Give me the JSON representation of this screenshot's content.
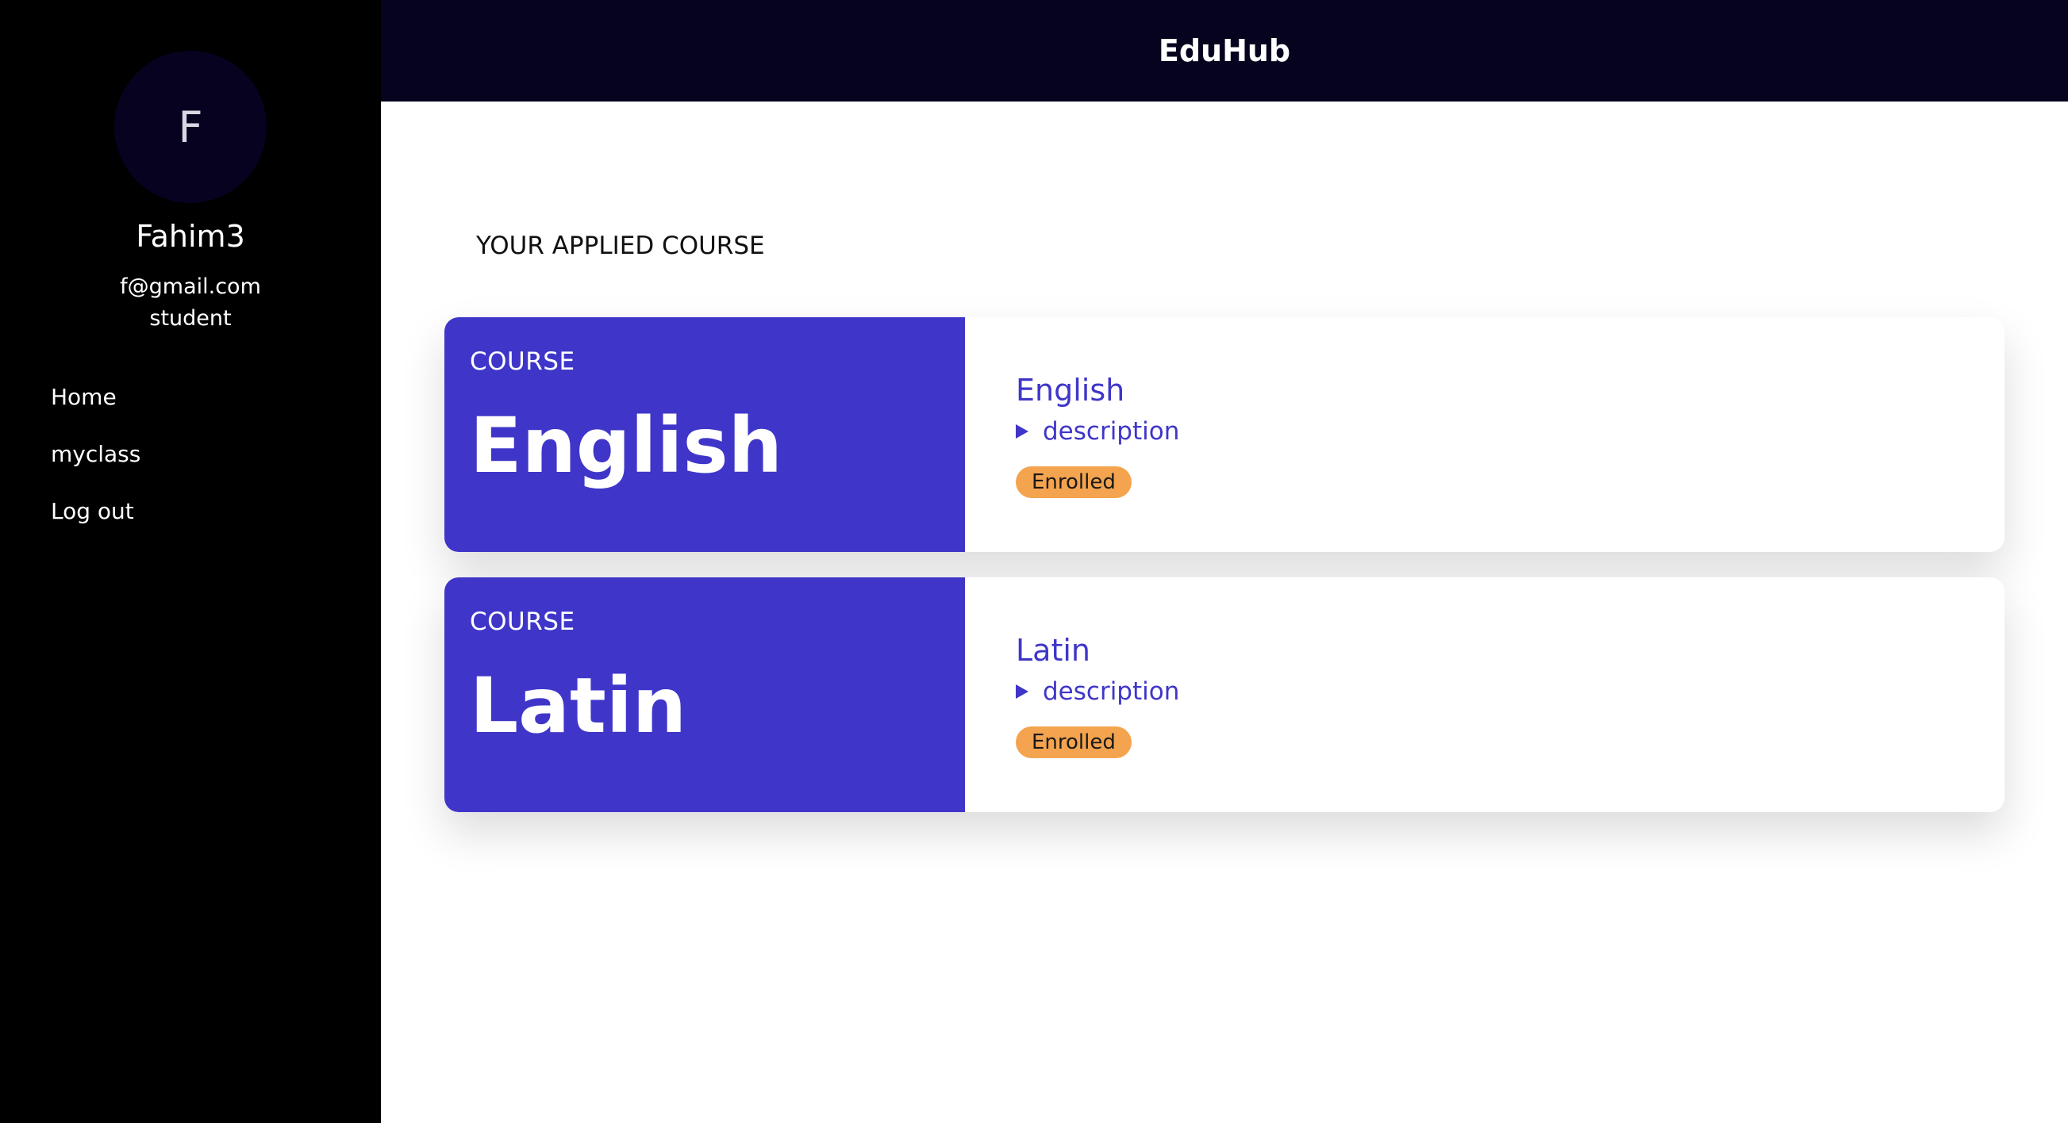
{
  "app": {
    "title": "EduHub"
  },
  "user": {
    "initial": "F",
    "name": "Fahim3",
    "email": "f@gmail.com",
    "role": "student"
  },
  "sidebar": {
    "items": [
      {
        "label": "Home"
      },
      {
        "label": "myclass"
      },
      {
        "label": "Log out"
      }
    ]
  },
  "main": {
    "section_title": "YOUR APPLIED COURSE",
    "courses": [
      {
        "label": "COURSE",
        "big_title": "English",
        "name": "English",
        "description_label": "description",
        "status": "Enrolled"
      },
      {
        "label": "COURSE",
        "big_title": "Latin",
        "name": "Latin",
        "description_label": "description",
        "status": "Enrolled"
      }
    ]
  },
  "colors": {
    "accent": "#3f36c9",
    "topbar": "#05031e",
    "sidebar": "#000000",
    "badge": "#f4a34e"
  }
}
